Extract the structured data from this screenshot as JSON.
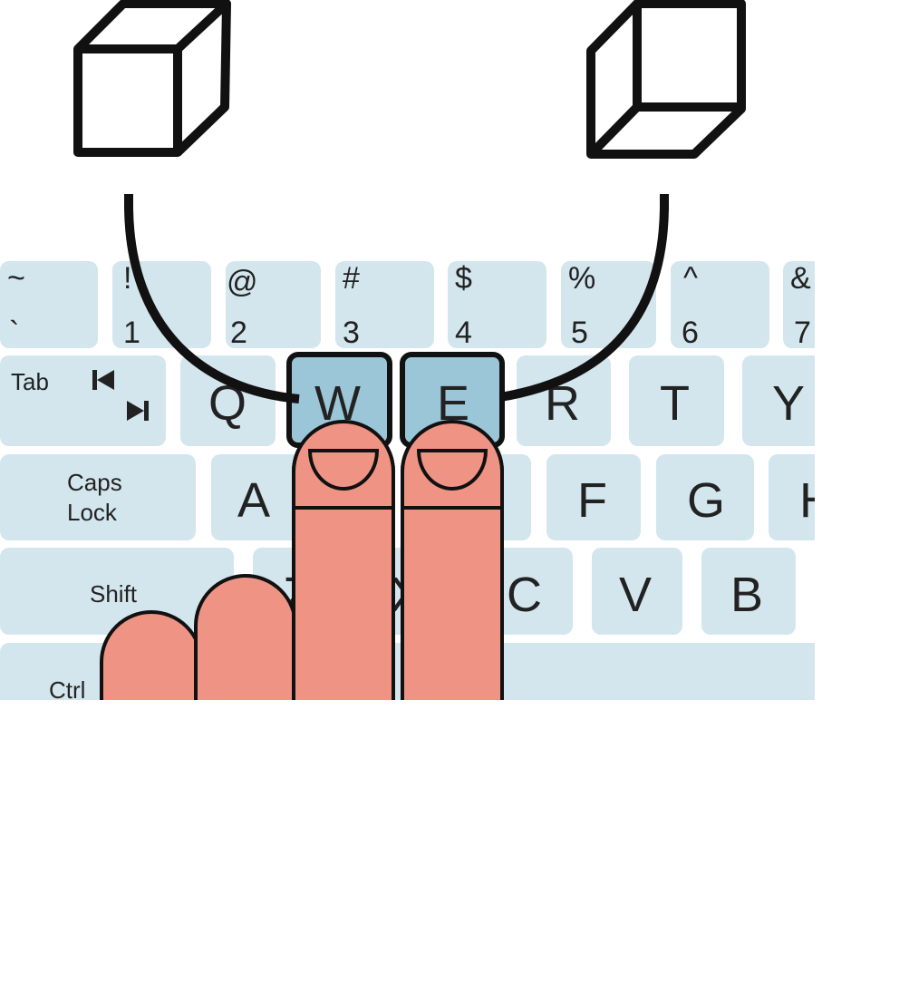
{
  "colors": {
    "key": "#d3e6ed",
    "highlighted_key": "#9ac6d8",
    "finger": "#ef9485",
    "outline": "#111111"
  },
  "icons": {
    "left_cube": "cube-rotated-left-icon",
    "right_cube": "cube-rotated-right-icon",
    "tab": "tab-arrows-icon"
  },
  "number_row": [
    {
      "top": "~",
      "bottom": "`"
    },
    {
      "top": "!",
      "bottom": "1"
    },
    {
      "top": "@",
      "bottom": "2"
    },
    {
      "top": "#",
      "bottom": "3"
    },
    {
      "top": "$",
      "bottom": "4"
    },
    {
      "top": "%",
      "bottom": "5"
    },
    {
      "top": "^",
      "bottom": "6"
    },
    {
      "top": "&",
      "bottom": "7"
    }
  ],
  "qwerty_row": {
    "tab": "Tab",
    "keys": [
      "Q",
      "W",
      "E",
      "R",
      "T",
      "Y"
    ]
  },
  "home_row": {
    "caps_line1": "Caps",
    "caps_line2": "Lock",
    "keys": [
      "A",
      "F",
      "G",
      "H"
    ]
  },
  "bottom_row": {
    "shift": "Shift",
    "keys": [
      "Z",
      "X",
      "C",
      "V",
      "B"
    ]
  },
  "space_row": {
    "ctrl": "Ctrl"
  },
  "highlighted_keys": [
    "W",
    "E"
  ]
}
